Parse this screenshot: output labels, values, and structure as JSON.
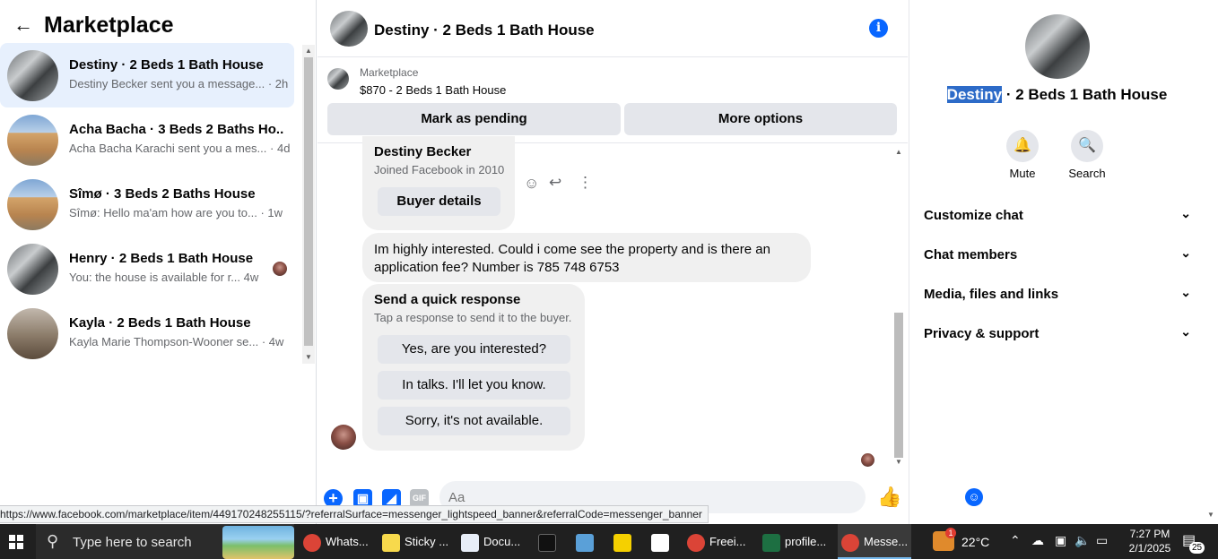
{
  "left": {
    "title": "Marketplace",
    "conversations": [
      {
        "title": "Destiny · 2 Beds 1 Bath House",
        "snippet": "Destiny Becker sent you a message...",
        "time": "· 2h"
      },
      {
        "title": "Acha Bacha · 3 Beds 2 Baths Ho...",
        "snippet": "Acha Bacha Karachi sent you a mes...",
        "time": "· 4d"
      },
      {
        "title": "Sîmø · 3 Beds 2 Baths House",
        "snippet": "Sîmø: Hello ma'am how are you to...",
        "time": "· 1w"
      },
      {
        "title": "Henry · 2 Beds 1 Bath House",
        "snippet": "You: the house is available for r...",
        "time": "4w"
      },
      {
        "title": "Kayla · 2 Beds 1 Bath House",
        "snippet": "Kayla Marie Thompson-Wooner se...",
        "time": "· 4w"
      }
    ]
  },
  "chat": {
    "title": "Destiny · 2 Beds 1 Bath House",
    "marketplace_label": "Marketplace",
    "listing": "$870 - 2 Beds 1 Bath House",
    "mark_pending": "Mark as pending",
    "more_options": "More options",
    "buyer_name": "Destiny Becker",
    "buyer_joined": "Joined Facebook in 2010",
    "buyer_details": "Buyer details",
    "message": "Im highly interested. Could i come see the property and is there an application fee? Number is 785 748 6753",
    "quick_title": "Send a quick response",
    "quick_sub": "Tap a response to send it to the buyer.",
    "quick_replies": [
      "Yes, are you interested?",
      "In talks. I'll let you know.",
      "Sorry, it's not available."
    ],
    "composer_placeholder": "Aa",
    "gif_label": "GIF"
  },
  "right": {
    "title_highlight": "Destiny",
    "title_rest": " · 2 Beds 1 Bath House",
    "mute": "Mute",
    "search": "Search",
    "sections": [
      "Customize chat",
      "Chat members",
      "Media, files and links",
      "Privacy & support"
    ]
  },
  "status_url": "https://www.facebook.com/marketplace/item/449170248255115/?referralSurface=messenger_lightspeed_banner&referralCode=messenger_banner",
  "taskbar": {
    "search_placeholder": "Type here to search",
    "apps": [
      "Whats...",
      "Sticky ...",
      "Docu...",
      "Freei...",
      "profile...",
      "Messe..."
    ],
    "temperature": "22°C",
    "time": "7:27 PM",
    "date": "2/1/2025",
    "notifications": "25",
    "weather_badge": "1"
  },
  "colors": {
    "accent": "#0866ff",
    "active_row": "#e7f0fd",
    "bubble": "#f0f0f0",
    "taskbar": "#202020"
  }
}
